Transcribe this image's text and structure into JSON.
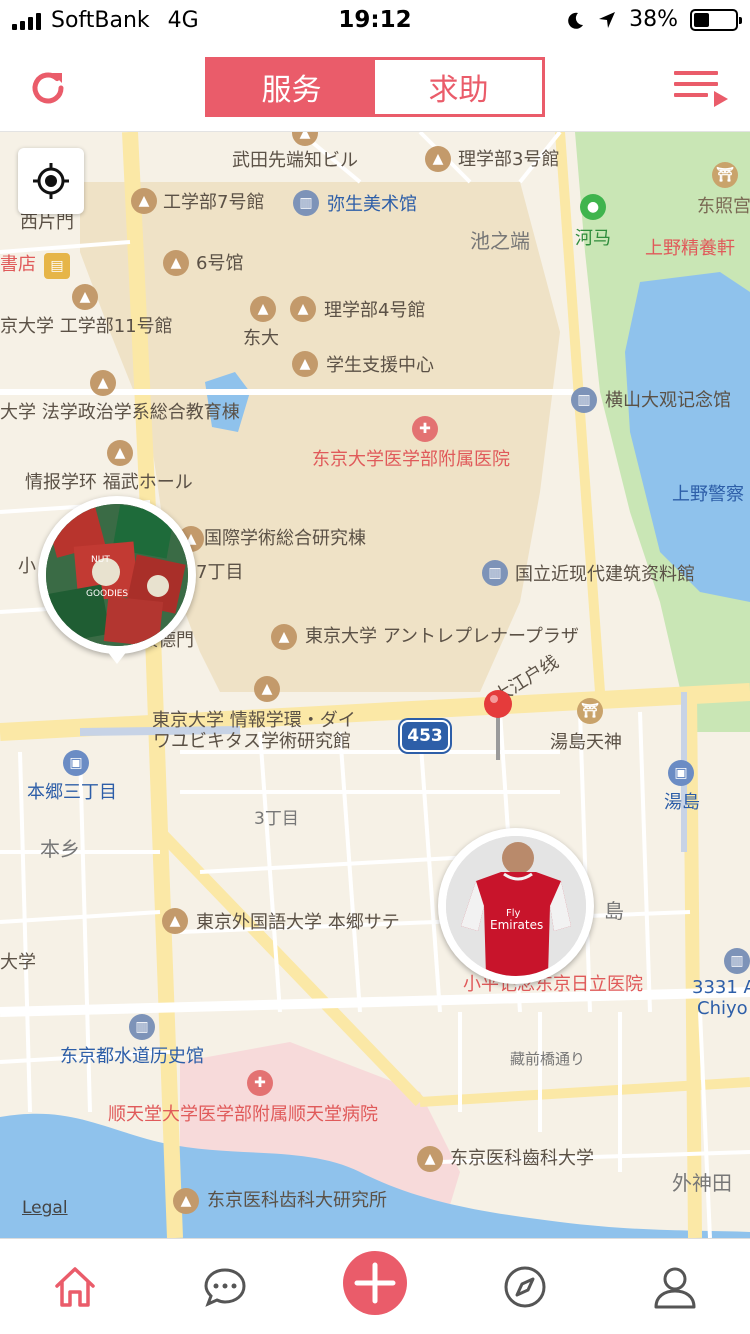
{
  "status_bar": {
    "carrier": "SoftBank",
    "network": "4G",
    "time": "19:12",
    "battery": "38%",
    "battery_level": 0.38
  },
  "header": {
    "tabs": [
      {
        "label": "服务",
        "active": true
      },
      {
        "label": "求助",
        "active": false
      }
    ],
    "icons": {
      "left": "refresh-icon",
      "right": "menu-list-icon"
    }
  },
  "map": {
    "labels": {
      "takeda": "武田先端知ビル",
      "rigakubu3": "理学部3号館",
      "kogakubu7": "工学部7号館",
      "yayoi": "弥生美术馆",
      "toshogu": "东照宫",
      "nishikatamon": "西片門",
      "ikenohata": "池之端",
      "kawama": "河马",
      "uenoseiyoken": "上野精養軒",
      "shoten": "書店",
      "gogokan": "6号馆",
      "kogakubu11": "京大学 工学部11号館",
      "rigakubu4": "理学部4号館",
      "todai": "东大",
      "gakusei": "学生支援中心",
      "yokoyama": "横山大观记念馆",
      "hougaku": "大学 法学政治学系総合教育棟",
      "hospital_todai": "东京大学医学部附属医院",
      "johogakkan": "情报学环 福武ホール",
      "uenokeisatsu": "上野警察",
      "kokusai": "国際学術総合研究棟",
      "nanachome": "7丁目",
      "kindai": "国立近现代建筑资料館",
      "kaitokumon": "懐德門",
      "entrepreneur": "東京大学 アントレプレナープラザ",
      "oedo": "大江户线",
      "ubiquitous_1": "東京大学 情報学環・ダイ",
      "ubiquitous_2": "ワユビキタス学術研究館",
      "route": "453",
      "yushimatenjin": "湯島天神",
      "hongo3": "本郷三丁目",
      "yushima": "湯島",
      "sanchome": "3丁目",
      "hongo": "本乡",
      "gaikokugo": "東京外国語大学 本郷サテ",
      "shima": "島",
      "daigaku": "大学",
      "kodaira": "小平记念东京日立医院",
      "arts_1": "3331 A",
      "arts_2": "Chiyo",
      "suido": "东京都水道历史馆",
      "kuramae": "藏前橋通り",
      "juntendo": "顺天堂大学医学部附属顺天堂病院",
      "ikashika": "东京医科齒科大学",
      "sotokanda": "外神田",
      "kenkyusho": "东京医科齿科大研究所",
      "small_ko": "小",
      "legal": "Legal"
    },
    "avatars": [
      {
        "name": "nut-goodies-bag",
        "caption_lines": [
          "NUT",
          "GOODIES"
        ]
      },
      {
        "name": "red-jersey",
        "caption_lines": [
          "Fly",
          "Emirates"
        ]
      }
    ],
    "colors": {
      "accent": "#ea5c6a",
      "water": "#8fc2ec",
      "park": "#c9e6b5",
      "campus": "#efe2c6",
      "road_major": "#fbe8a6"
    }
  },
  "tabbar": {
    "items": [
      {
        "icon": "home-icon",
        "active": true
      },
      {
        "icon": "chat-icon",
        "active": false
      },
      {
        "icon": "add-icon",
        "active": false
      },
      {
        "icon": "compass-icon",
        "active": false
      },
      {
        "icon": "profile-icon",
        "active": false
      }
    ]
  }
}
